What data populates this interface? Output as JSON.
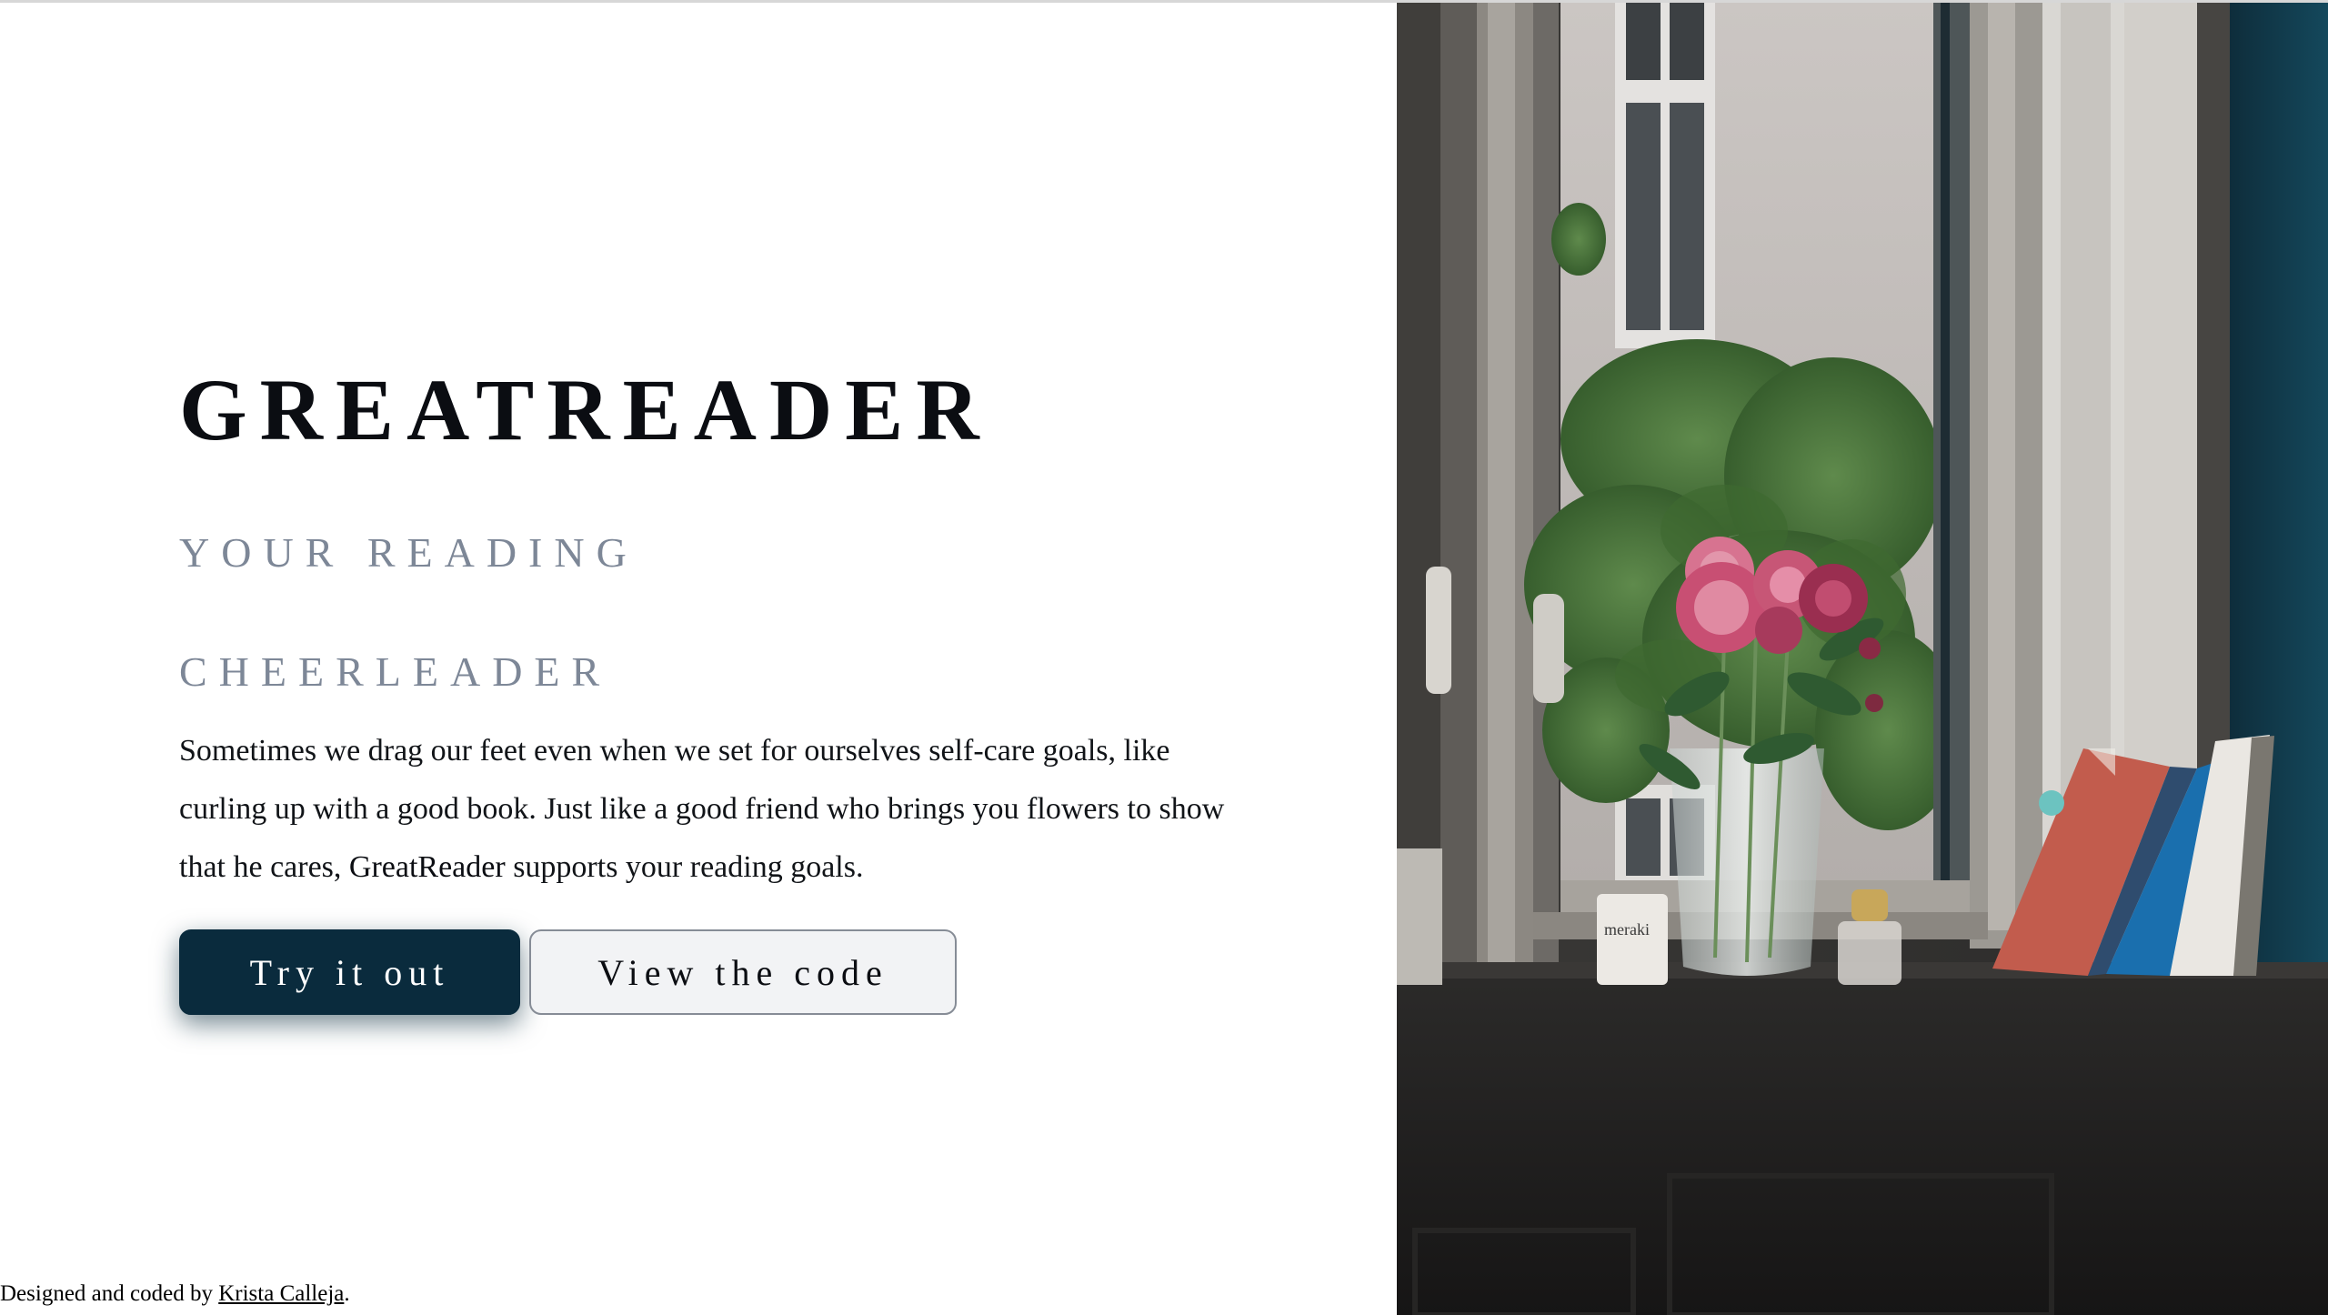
{
  "hero": {
    "brand": "GREATREADER",
    "tagline_line1": "YOUR READING",
    "tagline_line2": "CHEERLEADER",
    "description_before": "Sometimes we drag our feet even when we set for ourselves self-care goals, like curling up with a good book. Just like a good friend who brings you flowers to show that he cares, ",
    "description_brand": "GreatReader",
    "description_after": " supports your reading goals."
  },
  "buttons": {
    "primary_label": "Try it out",
    "secondary_label": "View the code"
  },
  "footer": {
    "prefix": "Designed and coded by ",
    "author_link": "Krista Calleja",
    "suffix": "."
  },
  "photo": {
    "candle_label": "meraki"
  },
  "colors": {
    "primary_button": "#0a2b3d",
    "tagline": "#7d8797",
    "secondary_button_bg": "#f2f3f5"
  }
}
